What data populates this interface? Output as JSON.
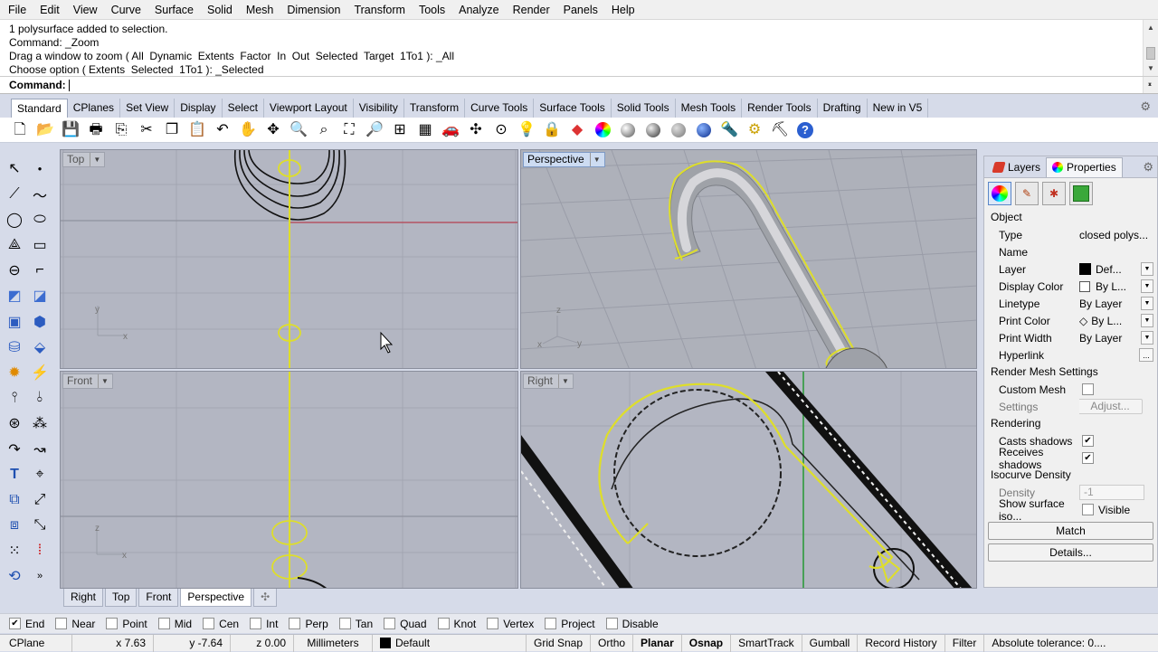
{
  "menu": [
    "File",
    "Edit",
    "View",
    "Curve",
    "Surface",
    "Solid",
    "Mesh",
    "Dimension",
    "Transform",
    "Tools",
    "Analyze",
    "Render",
    "Panels",
    "Help"
  ],
  "history": [
    "1 polysurface added to selection.",
    "Command: _Zoom",
    "Drag a window to zoom ( All  Dynamic  Extents  Factor  In  Out  Selected  Target  1To1 ): _All",
    "Choose option ( Extents  Selected  1To1 ): _Selected"
  ],
  "command_prompt": "Command:",
  "toolbar_tabs": [
    "Standard",
    "CPlanes",
    "Set View",
    "Display",
    "Select",
    "Viewport Layout",
    "Visibility",
    "Transform",
    "Curve Tools",
    "Surface Tools",
    "Solid Tools",
    "Mesh Tools",
    "Render Tools",
    "Drafting",
    "New in V5"
  ],
  "active_toolbar_tab": "Standard",
  "viewports": {
    "top": {
      "label": "Top"
    },
    "perspective": {
      "label": "Perspective"
    },
    "front": {
      "label": "Front"
    },
    "right": {
      "label": "Right"
    }
  },
  "viewport_tabs": [
    "Right",
    "Top",
    "Front",
    "Perspective"
  ],
  "active_viewport_tab": "Perspective",
  "osnaps": [
    {
      "label": "End",
      "checked": true
    },
    {
      "label": "Near",
      "checked": false
    },
    {
      "label": "Point",
      "checked": false
    },
    {
      "label": "Mid",
      "checked": false
    },
    {
      "label": "Cen",
      "checked": false
    },
    {
      "label": "Int",
      "checked": false
    },
    {
      "label": "Perp",
      "checked": false
    },
    {
      "label": "Tan",
      "checked": false
    },
    {
      "label": "Quad",
      "checked": false
    },
    {
      "label": "Knot",
      "checked": false
    },
    {
      "label": "Vertex",
      "checked": false
    },
    {
      "label": "Project",
      "checked": false
    },
    {
      "label": "Disable",
      "checked": false
    }
  ],
  "status": {
    "cplane": "CPlane",
    "x": "x 7.63",
    "y": "y -7.64",
    "z": "z 0.00",
    "units": "Millimeters",
    "layer": "Default",
    "grid_snap": "Grid Snap",
    "ortho": "Ortho",
    "planar": "Planar",
    "osnap": "Osnap",
    "smarttrack": "SmartTrack",
    "gumball": "Gumball",
    "record_history": "Record History",
    "filter": "Filter",
    "tolerance": "Absolute tolerance: 0...."
  },
  "panel": {
    "tabs": {
      "layers": "Layers",
      "properties": "Properties"
    },
    "object_section": "Object",
    "rows": [
      {
        "key": "Type",
        "value": "closed polys..."
      },
      {
        "key": "Name",
        "value": ""
      },
      {
        "key": "Layer",
        "value": "Def..."
      },
      {
        "key": "Display Color",
        "value": "By L..."
      },
      {
        "key": "Linetype",
        "value": "By Layer"
      },
      {
        "key": "Print Color",
        "value": "By L..."
      },
      {
        "key": "Print Width",
        "value": "By Layer"
      },
      {
        "key": "Hyperlink",
        "value": "..."
      }
    ],
    "render_mesh_section": "Render Mesh Settings",
    "custom_mesh": "Custom Mesh",
    "settings": "Settings",
    "adjust": "Adjust...",
    "rendering_section": "Rendering",
    "casts_shadows": "Casts shadows",
    "receives_shadows": "Receives shadows",
    "isocurve_section": "Isocurve Density",
    "density": "Density",
    "density_value": "-1",
    "show_iso": "Show surface iso...",
    "visible": "Visible",
    "match": "Match",
    "details": "Details..."
  },
  "axes": {
    "x": "x",
    "y": "y",
    "z": "z"
  },
  "colors": {
    "selection": "#e6e61a",
    "viewport_bg": "#b3b6c2",
    "accent": "#cddcf2"
  }
}
